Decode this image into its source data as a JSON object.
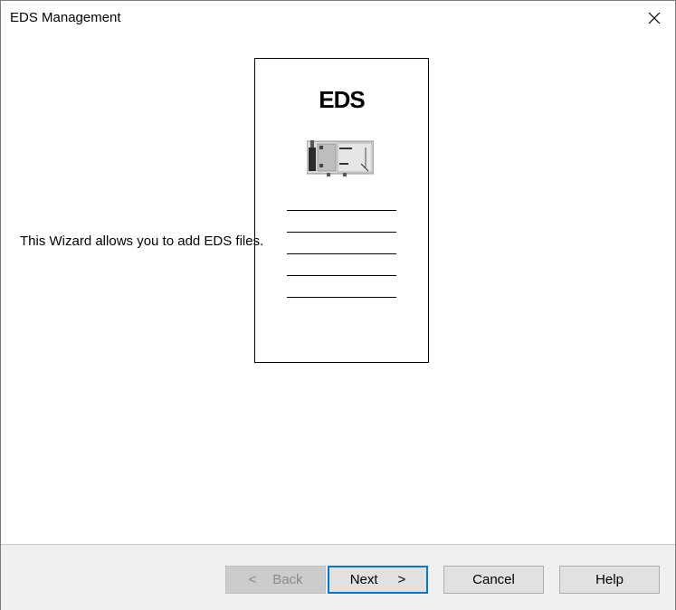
{
  "window": {
    "title": "EDS Management"
  },
  "content": {
    "intro": "This Wizard allows you to add EDS files.",
    "card_heading": "EDS"
  },
  "buttons": {
    "back_arrow": "<",
    "back_label": "Back",
    "next_label": "Next",
    "next_arrow": ">",
    "cancel_label": "Cancel",
    "help_label": "Help"
  },
  "colors": {
    "focus_accent": "#0078d7",
    "footer_bg": "#f0f0f0",
    "button_bg": "#e1e1e1"
  }
}
